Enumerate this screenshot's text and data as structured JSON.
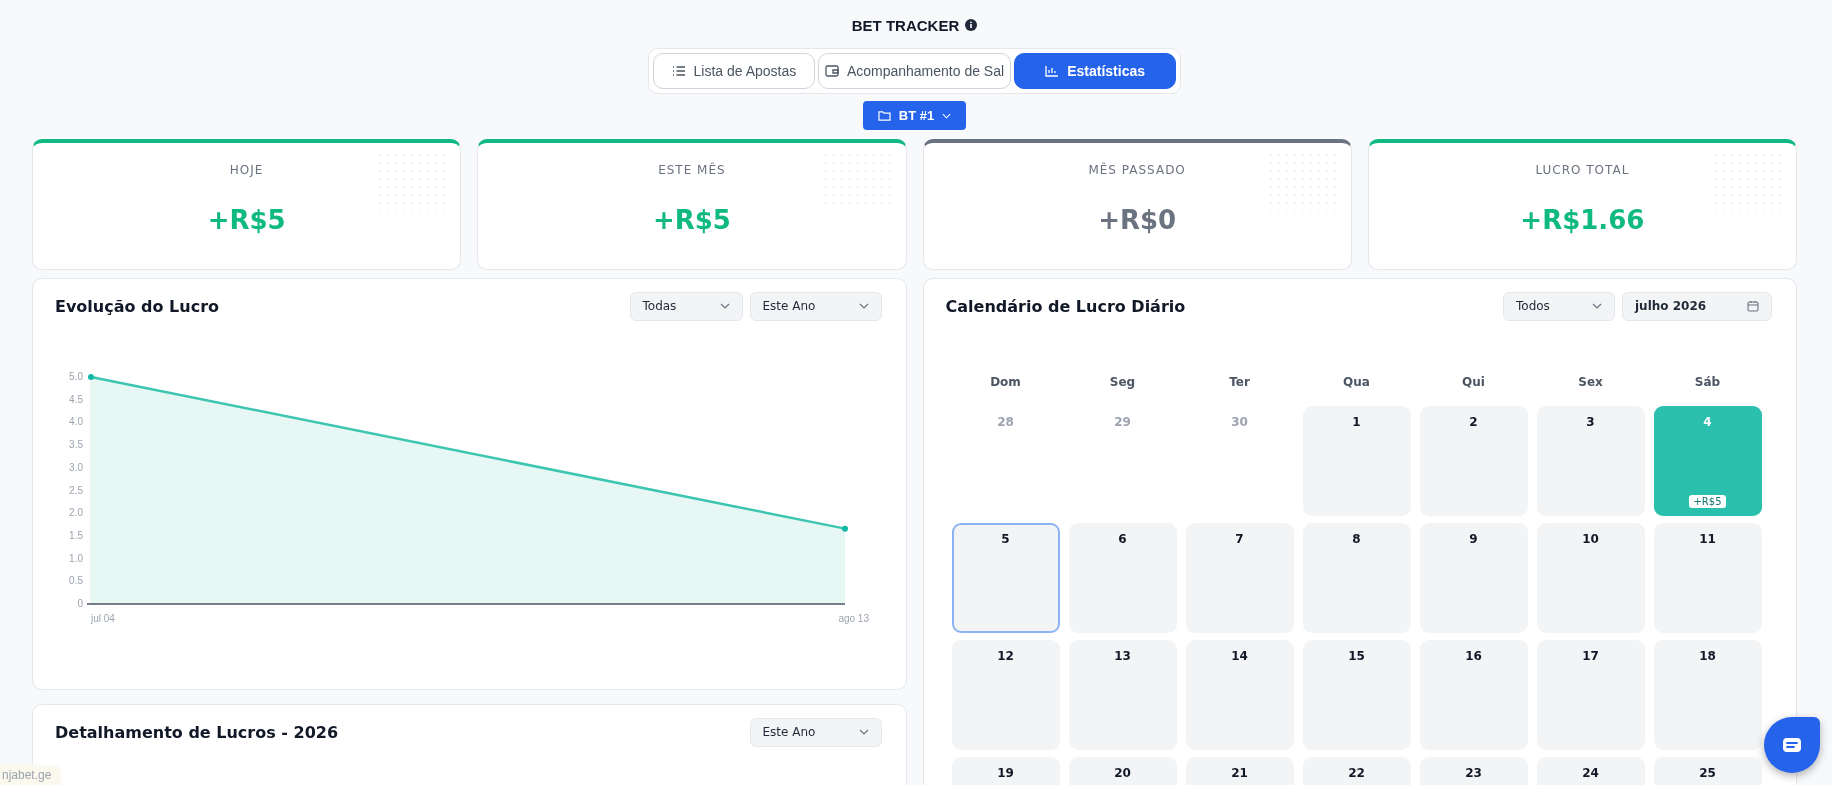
{
  "header": {
    "title": "BET TRACKER"
  },
  "tabs": [
    {
      "label": "Lista de Apostas",
      "selected": false
    },
    {
      "label": "Acompanhamento de Sal",
      "selected": false
    },
    {
      "label": "Estatísticas",
      "selected": true
    }
  ],
  "project_button": {
    "label": "BT #1"
  },
  "stats": [
    {
      "label": "HOJE",
      "value": "+R$5",
      "color": "#10b981"
    },
    {
      "label": "ESTE MÊS",
      "value": "+R$5",
      "color": "#10b981"
    },
    {
      "label": "MÊS PASSADO",
      "value": "+R$0",
      "color": "#6b7280"
    },
    {
      "label": "LUCRO TOTAL",
      "value": "+R$1.66",
      "color": "#10b981"
    }
  ],
  "profit_chart": {
    "title": "Evolução do Lucro",
    "filters": [
      "Todas",
      "Este Ano"
    ],
    "chart_data": {
      "type": "area",
      "categories": [
        "jul 04",
        "ago 13"
      ],
      "series": [
        {
          "color": "#3cc5b0",
          "values": [
            5,
            1.66
          ]
        }
      ],
      "ylim": [
        0,
        5
      ],
      "yticks": [
        {
          "value": 0,
          "label": "0"
        },
        {
          "value": 0.5,
          "label": "0.5"
        },
        {
          "value": 1,
          "label": "1.0"
        },
        {
          "value": 1.5,
          "label": "1.5"
        },
        {
          "value": 2,
          "label": "2.0"
        },
        {
          "value": 2.5,
          "label": "2.5"
        },
        {
          "value": 3,
          "label": "3.0"
        },
        {
          "value": 3.5,
          "label": "3.5"
        },
        {
          "value": 4,
          "label": "4.0"
        },
        {
          "value": 4.5,
          "label": "4.5"
        },
        {
          "value": 5,
          "label": "5.0"
        }
      ]
    }
  },
  "breakdown": {
    "title": "Detalhamento de Lucros - 2026",
    "filter": "Este Ano"
  },
  "calendar": {
    "title": "Calendário de Lucro Diário",
    "filter": "Todos",
    "month": "julho 2026",
    "weekdays": [
      "Dom",
      "Seg",
      "Ter",
      "Qua",
      "Qui",
      "Sex",
      "Sáb"
    ],
    "weeks": [
      [
        {
          "day": "28",
          "kind": "outside"
        },
        {
          "day": "29",
          "kind": "outside"
        },
        {
          "day": "30",
          "kind": "outside"
        },
        {
          "day": "1",
          "kind": "day"
        },
        {
          "day": "2",
          "kind": "day"
        },
        {
          "day": "3",
          "kind": "day"
        },
        {
          "day": "4",
          "kind": "profit",
          "amount": "+R$5"
        }
      ],
      [
        {
          "day": "5",
          "kind": "today"
        },
        {
          "day": "6",
          "kind": "day"
        },
        {
          "day": "7",
          "kind": "day"
        },
        {
          "day": "8",
          "kind": "day"
        },
        {
          "day": "9",
          "kind": "day"
        },
        {
          "day": "10",
          "kind": "day"
        },
        {
          "day": "11",
          "kind": "day"
        }
      ],
      [
        {
          "day": "12",
          "kind": "day"
        },
        {
          "day": "13",
          "kind": "day"
        },
        {
          "day": "14",
          "kind": "day"
        },
        {
          "day": "15",
          "kind": "day"
        },
        {
          "day": "16",
          "kind": "day"
        },
        {
          "day": "17",
          "kind": "day"
        },
        {
          "day": "18",
          "kind": "day"
        }
      ],
      [
        {
          "day": "19",
          "kind": "day"
        },
        {
          "day": "20",
          "kind": "day"
        },
        {
          "day": "21",
          "kind": "day"
        },
        {
          "day": "22",
          "kind": "day"
        },
        {
          "day": "23",
          "kind": "day"
        },
        {
          "day": "24",
          "kind": "day"
        },
        {
          "day": "25",
          "kind": "day"
        }
      ]
    ]
  },
  "link_preview": "njabet.ge"
}
